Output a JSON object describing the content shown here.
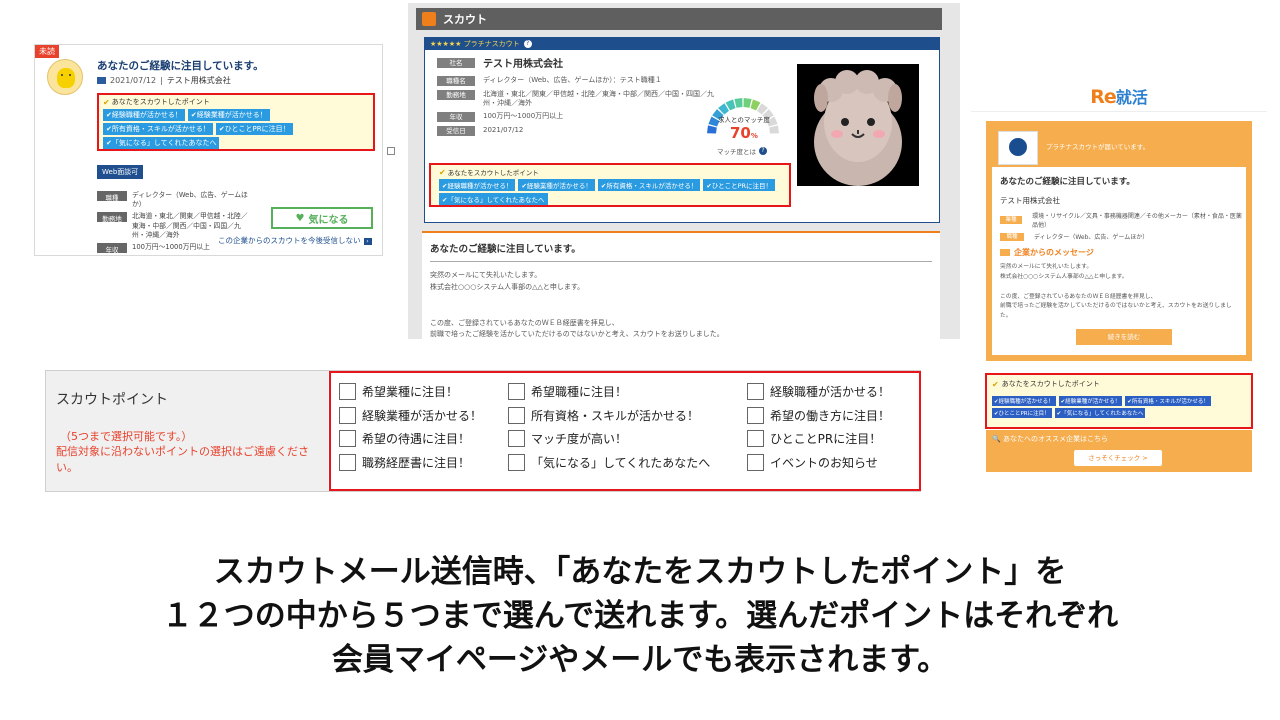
{
  "colors": {
    "accent_orange": "#ef7f1a",
    "tag_blue": "#2a9be0",
    "highlight_red": "#e8151b",
    "navy": "#1e4f8c",
    "green": "#56b05a"
  },
  "panel1": {
    "unread_badge": "未読",
    "title": "あなたのご経験に注目しています。",
    "date": "2021/07/12",
    "separator": "|",
    "company": "テスト用株式会社",
    "points_heading": "あなたをスカウトしたポイント",
    "tags": [
      "経験職種が活かせる！",
      "経験業種が活かせる！",
      "所有資格・スキルが活かせる！",
      "ひとことPRに注目！",
      "「気になる」してくれたあなたへ"
    ],
    "web_interview_button": "Web面談可",
    "rows": [
      {
        "label": "職種",
        "value": "ディレクター（Web、広告、ゲームほか）"
      },
      {
        "label": "勤務地",
        "value": "北海道・東北／関東／甲信越・北陸／東海・中部／関西／中国・四国／九州・沖縄／海外"
      },
      {
        "label": "年収",
        "value": "100万円～1000万円以上"
      }
    ],
    "kininaru_button": "気になる",
    "heart_icon": "♥",
    "decline_link": "この企業からのスカウトを今後受信しない"
  },
  "panel2": {
    "header_title": "スカウト",
    "platinum_label": "★★★★★ プラチナスカウト",
    "help_glyph": "?",
    "rows": [
      {
        "label": "社名",
        "value": "テスト用株式会社"
      },
      {
        "label": "職種名",
        "value": "ディレクター（Web、広告、ゲームほか）：テスト職種１"
      },
      {
        "label": "勤務地",
        "value": "北海道・東北／関東／甲信越・北陸／東海・中部／関西／中国・四国／九州・沖縄／海外"
      },
      {
        "label": "年収",
        "value": "100万円～1000万円以上"
      },
      {
        "label": "受信日",
        "value": "2021/07/12"
      }
    ],
    "gauge_label": "求人とのマッチ度",
    "gauge_value": "70",
    "gauge_unit": "%",
    "gauge_level": 0.7,
    "match_help": "マッチ度とは",
    "points_heading": "あなたをスカウトしたポイント",
    "tags": [
      "経験職種が活かせる！",
      "経験業種が活かせる！",
      "所有資格・スキルが活かせる！",
      "ひとことPRに注目！",
      "「気になる」してくれたあなたへ"
    ],
    "mail_title": "あなたのご経験に注目しています。",
    "mail_lines": [
      "突然のメールにて失礼いたします。",
      "株式会社○○○システム人事部の△△と申します。",
      "",
      "",
      "この度、ご登録されているあなたのＷＥＢ経歴書を拝見し、",
      "前職で培ったご経験を活かしていただけるのではないかと考え、スカウトをお送りしました。"
    ]
  },
  "panel3": {
    "logo_re": "Re",
    "logo_text": "就活",
    "header_text": "プラチナスカウトが届いています。",
    "title": "あなたのご経験に注目しています。",
    "company": "テスト用株式会社",
    "rows": [
      {
        "label": "業種",
        "value": "環境・リサイクル／文具・事務機器関連／その他メーカー（素材・食品・医薬品他）"
      },
      {
        "label": "職種",
        "value": "ディレクター（Web、広告、ゲームほか）"
      }
    ],
    "message_heading": "企業からのメッセージ",
    "message_lines": [
      "突然のメールにて失礼いたします。",
      "株式会社○○○システム人事部の△△と申します。",
      "",
      "この度、ご登録されているあなたのＷＥＢ経歴書を拝見し、",
      "前職で培ったご経験を活かしていただけるのではないかと考え、スカウトをお送りしました。"
    ],
    "read_more_button": "続きを読む",
    "points_heading": "あなたをスカウトしたポイント",
    "tags": [
      "経験職種が活かせる！",
      "経験業種が活かせる！",
      "所有資格・スキルが活かせる！",
      "ひとことPRに注目！",
      "「気になる」してくれたあなたへ"
    ],
    "recommend_text": "あなたへのオススメ企業はこちら",
    "check_button": "さっそくチェック >"
  },
  "scout_form": {
    "title": "スカウトポイント",
    "note_limit": "（5つまで選択可能です。）",
    "note_caution": "配信対象に沿わないポイントの選択はご遠慮ください。",
    "columns": [
      [
        "希望業種に注目！",
        "経験業種が活かせる！",
        "希望の待遇に注目！",
        "職務経歴書に注目！"
      ],
      [
        "希望職種に注目！",
        "所有資格・スキルが活かせる！",
        "マッチ度が高い！",
        "「気になる」してくれたあなたへ"
      ],
      [
        "経験職種が活かせる！",
        "希望の働き方に注目！",
        "ひとことPRに注目！",
        "イベントのお知らせ"
      ]
    ]
  },
  "caption": {
    "line1": "スカウトメール送信時、「あなたをスカウトしたポイント」を",
    "line2": "１２つの中から５つまで選んで送れます。選んだポイントはそれぞれ",
    "line3": "会員マイページやメールでも表示されます。"
  }
}
